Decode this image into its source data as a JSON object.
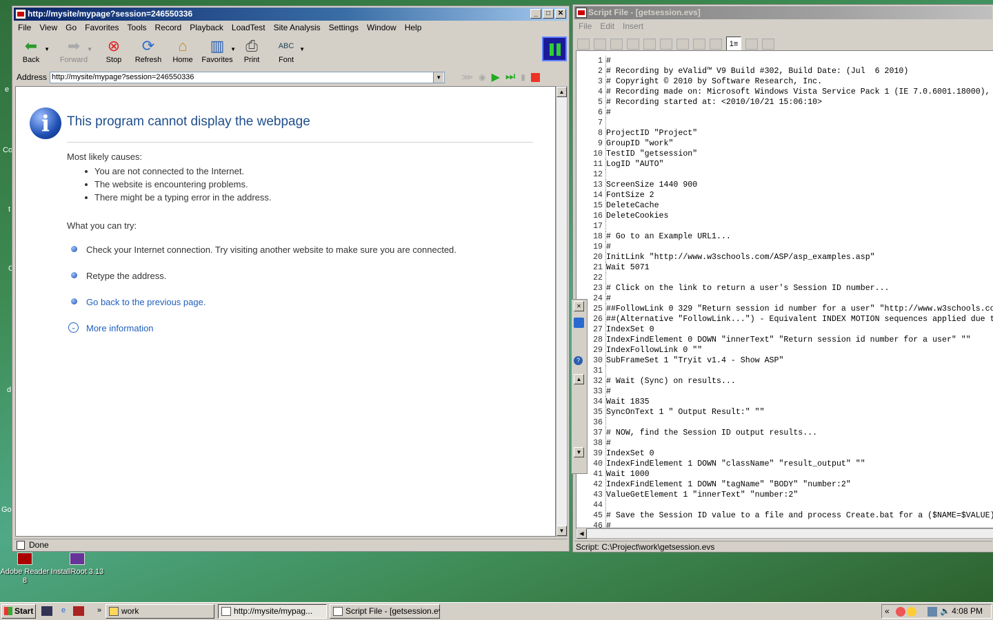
{
  "desktop": {
    "icons": [
      {
        "label": "Adobe Reader 8"
      },
      {
        "label": "InstallRoot 3.13"
      }
    ],
    "partial_labels": [
      "e",
      "Co",
      "t",
      "C",
      "d",
      "Go"
    ]
  },
  "browser": {
    "title": "http://mysite/mypage?session=246550336",
    "menu": [
      "File",
      "View",
      "Go",
      "Favorites",
      "Tools",
      "Record",
      "Playback",
      "LoadTest",
      "Site Analysis",
      "Settings",
      "Window",
      "Help"
    ],
    "toolbar": {
      "back": "Back",
      "forward": "Forward",
      "stop": "Stop",
      "refresh": "Refresh",
      "home": "Home",
      "favorites": "Favorites",
      "print": "Print",
      "font": "Font"
    },
    "address_label": "Address",
    "address_value": "http://mysite/mypage?session=246550336",
    "status": "Done",
    "page": {
      "title": "This program cannot display the webpage",
      "causes_heading": "Most likely causes:",
      "causes": [
        "You are not connected to the Internet.",
        "The website is encountering problems.",
        "There might be a typing error in the address."
      ],
      "try_heading": "What you can try:",
      "try_items": [
        "Check your Internet connection. Try visiting another website to make sure you are connected.",
        "Retype the address."
      ],
      "back_link": "Go back to the previous page.",
      "more_info": "More information"
    }
  },
  "script": {
    "title": "Script File - [getsession.evs]",
    "menu": [
      "File",
      "Edit",
      "Insert"
    ],
    "status": "Script: C:\\Project\\work\\getsession.evs",
    "lines": [
      "#",
      "# Recording by eValid™ V9 Build #302, Build Date: (Jul  6 2010)",
      "# Copyright © 2010 by Software Research, Inc.",
      "# Recording made on: Microsoft Windows Vista Service Pack 1 (IE 7.0.6001.18000),",
      "# Recording started at: <2010/10/21 15:06:10>",
      "#",
      "",
      "ProjectID \"Project\"",
      "GroupID \"work\"",
      "TestID \"getsession\"",
      "LogID \"AUTO\"",
      "",
      "ScreenSize 1440 900",
      "FontSize 2",
      "DeleteCache",
      "DeleteCookies",
      "",
      "# Go to an Example URL1...",
      "#",
      "InitLink \"http://www.w3schools.com/ASP/asp_examples.asp\"",
      "Wait 5071",
      "",
      "# Click on the link to return a user's Session ID number...",
      "#",
      "##FollowLink 0 329 \"Return session id number for a user\" \"http://www.w3schools.co",
      "##(Alternative \"FollowLink...\") - Equivalent INDEX MOTION sequences applied due t",
      "IndexSet 0",
      "IndexFindElement 0 DOWN \"innerText\" \"Return session id number for a user\" \"\"",
      "IndexFollowLink 0 \"\"",
      "SubFrameSet 1 \"Tryit v1.4 - Show ASP\"",
      "",
      "# Wait (Sync) on results...",
      "#",
      "Wait 1835",
      "SyncOnText 1 \" Output Result:\" \"\"",
      "",
      "# NOW, find the Session ID output results...",
      "#",
      "IndexSet 0",
      "IndexFindElement 1 DOWN \"className\" \"result_output\" \"\"",
      "Wait 1000",
      "IndexFindElement 1 DOWN \"tagName\" \"BODY\" \"number:2\"",
      "ValueGetElement 1 \"innerText\" \"number:2\"",
      "",
      "# Save the Session ID value to a file and process Create.bat for a ($NAME=$VALUE)",
      "#"
    ]
  },
  "taskbar": {
    "start": "Start",
    "tasks": [
      "work",
      "http://mysite/mypag...",
      "Script File - [getsession.evs]"
    ],
    "clock": "4:08 PM"
  }
}
